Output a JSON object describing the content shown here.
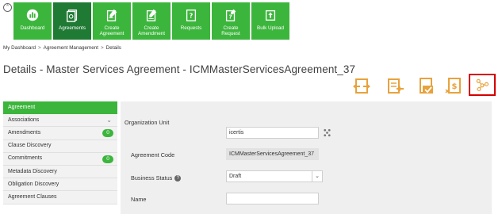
{
  "colors": {
    "brand_green": "#3cb53c",
    "active_green": "#1f7a34",
    "action_orange": "#e8a23c",
    "highlight_red": "#d40000"
  },
  "nav": {
    "up_icon": "chevron-up-icon",
    "tiles": [
      {
        "label": "Dashboard",
        "icon": "dashboard-icon",
        "active": false
      },
      {
        "label": "Agreements",
        "icon": "agreements-icon",
        "active": true
      },
      {
        "label": "Create\nAgreement",
        "icon": "create-agreement-icon",
        "active": false
      },
      {
        "label": "Create\nAmendment",
        "icon": "create-amendment-icon",
        "active": false
      },
      {
        "label": "Requests",
        "icon": "requests-icon",
        "active": false
      },
      {
        "label": "Create\nRequest",
        "icon": "create-request-icon",
        "active": false
      },
      {
        "label": "Bulk Upload",
        "icon": "bulk-upload-icon",
        "active": false
      }
    ]
  },
  "breadcrumb": {
    "items": [
      "My Dashboard",
      "Agreement Management",
      "Details"
    ],
    "separator": ">"
  },
  "page": {
    "title": "Details - Master Services Agreement - ICMMasterServicesAgreement_37"
  },
  "actions": [
    {
      "icon": "assign-agreement-icon"
    },
    {
      "icon": "send-document-icon"
    },
    {
      "icon": "approve-agreement-icon"
    },
    {
      "icon": "agreement-workflow-icon"
    },
    {
      "icon": "relationship-graph-icon",
      "highlighted": true
    }
  ],
  "sidebar": {
    "items": [
      {
        "label": "Agreement",
        "active": true
      },
      {
        "label": "Associations",
        "chevron": "chevron-down-icon"
      },
      {
        "label": "Amendments",
        "badge": "0"
      },
      {
        "label": "Clause Discovery"
      },
      {
        "label": "Commitments",
        "badge": "0"
      },
      {
        "label": "Metadata Discovery"
      },
      {
        "label": "Obligation Discovery"
      },
      {
        "label": "Agreement Clauses"
      }
    ]
  },
  "form": {
    "org_unit": {
      "label": "Organization Unit",
      "value": "icertis",
      "lookup_icon": "org-tree-icon"
    },
    "agreement_code": {
      "label": "Agreement Code",
      "value": "ICMMasterServicesAgreement_37"
    },
    "business_status": {
      "label": "Business Status",
      "value": "Draft",
      "info_icon": "info-icon",
      "info_glyph": "?",
      "arrow": "chevron-down-icon"
    },
    "name": {
      "label": "Name",
      "value": ""
    }
  }
}
